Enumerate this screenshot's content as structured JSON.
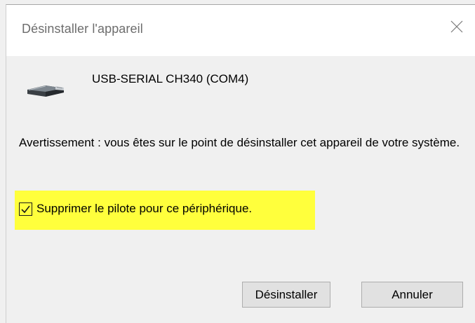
{
  "dialog": {
    "title": "Désinstaller l'appareil",
    "close_icon": "close-icon"
  },
  "device": {
    "icon": "usb-serial-device-icon",
    "name": "USB-SERIAL CH340 (COM4)"
  },
  "warning": {
    "text": "Avertissement : vous êtes sur le point de désinstaller cet appareil de votre système."
  },
  "option": {
    "label": "Supprimer le pilote pour ce périphérique.",
    "checked": true,
    "highlight_color": "#ffff3c"
  },
  "buttons": {
    "uninstall_label": "Désinstaller",
    "cancel_label": "Annuler"
  },
  "colors": {
    "dialog_background": "#f0f0f0",
    "title_background": "#ffffff",
    "title_text": "#6d6d6d",
    "button_background": "#e1e1e1"
  }
}
